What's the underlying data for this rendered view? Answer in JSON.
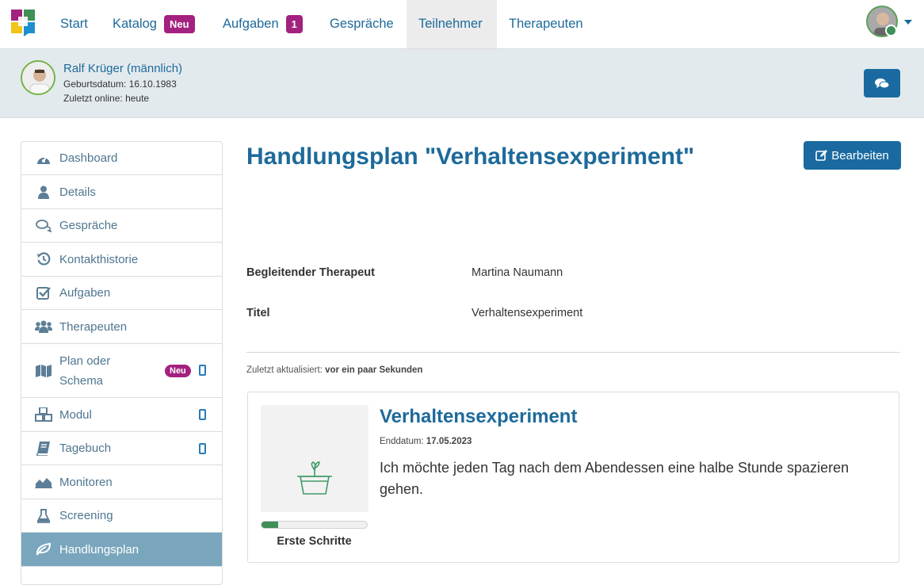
{
  "nav": {
    "items": [
      {
        "label": "Start"
      },
      {
        "label": "Katalog",
        "badge": "Neu"
      },
      {
        "label": "Aufgaben",
        "badge": "1"
      },
      {
        "label": "Gespräche"
      },
      {
        "label": "Teilnehmer",
        "active": true
      },
      {
        "label": "Therapeuten"
      }
    ],
    "accent_color": "#1d6a9a",
    "badge_color": "#a3217f"
  },
  "patient": {
    "name": "Ralf Krüger (männlich)",
    "birth_label": "Geburtsdatum:",
    "birth_value": "16.10.1983",
    "online_label": "Zuletzt online:",
    "online_value": "heute",
    "chat_icon": "comments-icon"
  },
  "sidebar": {
    "items": [
      {
        "label": "Dashboard",
        "icon": "dashboard-icon"
      },
      {
        "label": "Details",
        "icon": "user-icon"
      },
      {
        "label": "Gespräche",
        "icon": "comments-icon"
      },
      {
        "label": "Kontakthistorie",
        "icon": "history-icon"
      },
      {
        "label": "Aufgaben",
        "icon": "checkbox-icon"
      },
      {
        "label": "Therapeuten",
        "icon": "users-icon"
      },
      {
        "label": "Plan oder",
        "label2": "Schema",
        "icon": "map-icon",
        "badge": "Neu",
        "mobile": true
      },
      {
        "label": "Modul",
        "icon": "cubes-icon",
        "mobile": true
      },
      {
        "label": "Tagebuch",
        "icon": "book-icon",
        "mobile": true
      },
      {
        "label": "Monitoren",
        "icon": "area-chart-icon"
      },
      {
        "label": "Screening",
        "icon": "flask-icon"
      },
      {
        "label": "Handlungsplan",
        "icon": "leaf-icon",
        "active": true
      }
    ],
    "active_color": "#7aa6bd"
  },
  "main": {
    "title": "Handlungsplan \"Verhaltensexperiment\"",
    "edit_label": "Bearbeiten",
    "fields": [
      {
        "label": "Begleitender Therapeut",
        "value": "Martina Naumann"
      },
      {
        "label": "Titel",
        "value": "Verhaltensexperiment"
      }
    ],
    "updated_label": "Zuletzt aktualisiert:",
    "updated_value": "vor ein paar Sekunden"
  },
  "card": {
    "title": "Verhaltensexperiment",
    "end_label": "Enddatum:",
    "end_value": "17.05.2023",
    "description": "Ich möchte jeden Tag nach dem Abendessen eine halbe Stunde spazieren gehen.",
    "progress_fraction": 0.16,
    "stage": "Erste Schritte",
    "progress_color": "#3f8f57",
    "image_icon": "plant-pot-icon"
  }
}
